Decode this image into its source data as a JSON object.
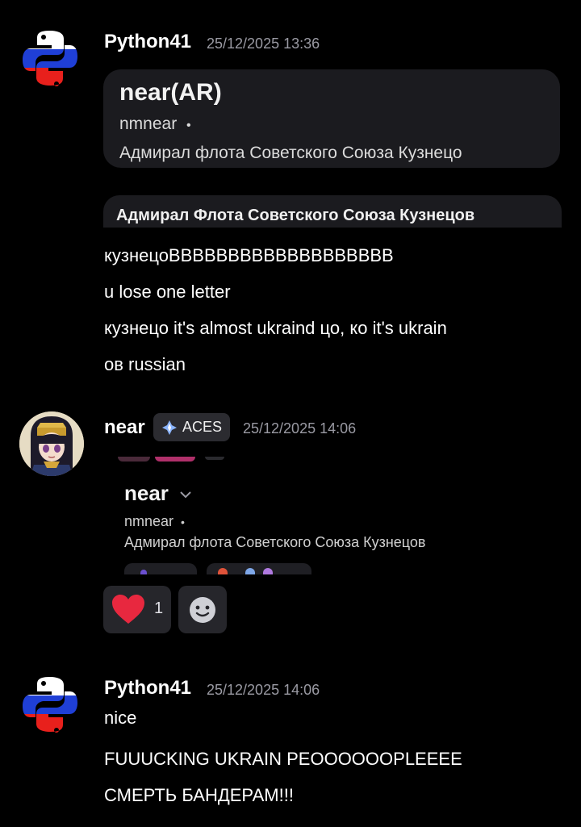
{
  "messages": [
    {
      "author": "Python41",
      "timestamp": "25/12/2025 13:36",
      "embed_profile": {
        "name": "near(AR)",
        "username": "nmnear",
        "separator": "•",
        "bio": "Адмирал флота Советского Союза Кузнецо"
      },
      "embed_strip": "Адмирал Флота Советского Союза Кузнецов",
      "lines": [
        "кузнецоВВВВВВВВВВВВВВВВВВВ",
        "u lose one letter",
        "кузнецо it's almost ukraind цо, ко it's ukrain",
        "ов russian"
      ]
    },
    {
      "author": "near",
      "badge": "ACES",
      "timestamp": "25/12/2025 14:06",
      "embed_profile": {
        "name": "near",
        "username": "nmnear",
        "separator": "•",
        "bio": "Адмирал флота Советского Союза Кузнецов"
      },
      "reactions": [
        {
          "emoji": "heart-icon",
          "count": "1"
        }
      ]
    },
    {
      "author": "Python41",
      "timestamp": "25/12/2025 14:06",
      "lines": [
        "nice",
        "FUUUCKING UKRAIN PEOOOOOOPLEEEE",
        "СМЕРТЬ БАНДЕРАМ!!!"
      ]
    }
  ],
  "colors": {
    "background": "#000000",
    "embed_bg": "#1b1b1f",
    "timestamp": "#9a9aa3",
    "heart": "#e8283f",
    "badge_bg": "#2b2b30"
  }
}
